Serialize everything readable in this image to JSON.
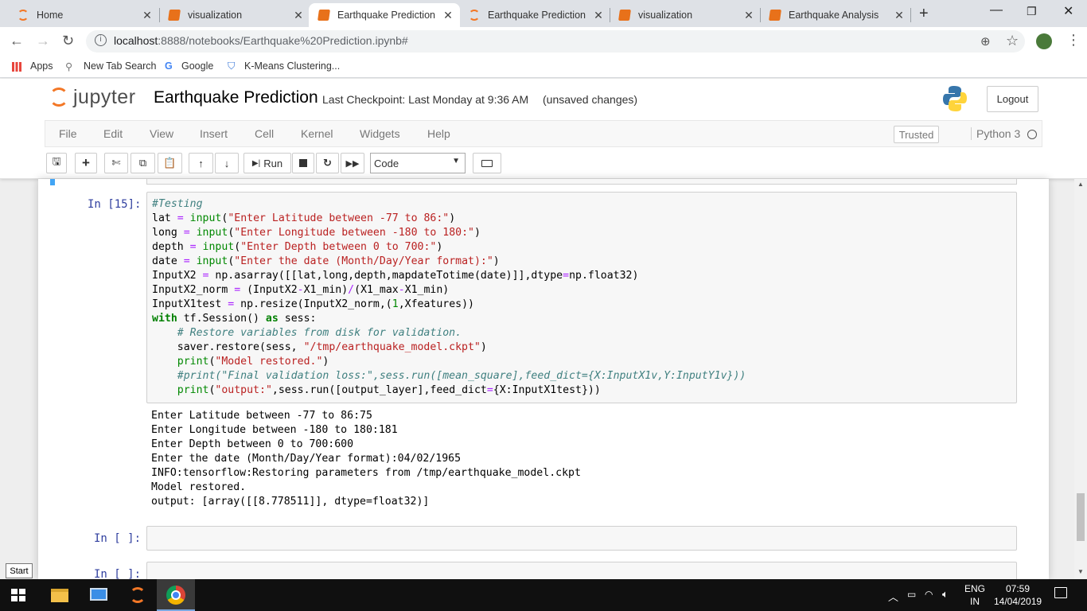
{
  "browser": {
    "tabs": [
      {
        "label": "Home",
        "icon": "jupyter-icon",
        "active": false
      },
      {
        "label": "visualization",
        "icon": "notebook-icon",
        "active": false
      },
      {
        "label": "Earthquake Prediction",
        "icon": "notebook-icon",
        "active": true
      },
      {
        "label": "Earthquake Prediction",
        "icon": "jupyter-icon",
        "active": false
      },
      {
        "label": "visualization",
        "icon": "notebook-icon",
        "active": false
      },
      {
        "label": "Earthquake Analysis",
        "icon": "notebook-icon",
        "active": false
      }
    ],
    "url_host": "localhost",
    "url_rest": ":8888/notebooks/Earthquake%20Prediction.ipynb#",
    "bookmarks": [
      "Apps",
      "New Tab Search",
      "Google",
      "K-Means Clustering..."
    ]
  },
  "jupyter": {
    "logo_text": "jupyter",
    "notebook_title": "Earthquake Prediction",
    "checkpoint": "Last Checkpoint: Last Monday at 9:36 AM",
    "unsaved": "(unsaved changes)",
    "logout": "Logout",
    "menus": [
      "File",
      "Edit",
      "View",
      "Insert",
      "Cell",
      "Kernel",
      "Widgets",
      "Help"
    ],
    "trusted": "Trusted",
    "kernel": "Python 3",
    "toolbar": {
      "run_label": "Run",
      "cell_type": "Code"
    }
  },
  "cells": {
    "cell1": {
      "prompt": "In [15]:",
      "code_lines": [
        "#Testing",
        "lat = input(\"Enter Latitude between -77 to 86:\")",
        "long = input(\"Enter Longitude between -180 to 180:\")",
        "depth = input(\"Enter Depth between 0 to 700:\")",
        "date = input(\"Enter the date (Month/Day/Year format):\")",
        "InputX2 = np.asarray([[lat,long,depth,mapdateTotime(date)]],dtype=np.float32)",
        "InputX2_norm = (InputX2-X1_min)/(X1_max-X1_min)",
        "InputX1test = np.resize(InputX2_norm,(1,Xfeatures))",
        "with tf.Session() as sess:",
        "    # Restore variables from disk for validation.",
        "    saver.restore(sess, \"/tmp/earthquake_model.ckpt\")",
        "    print(\"Model restored.\")",
        "    #print(\"Final validation loss:\",sess.run([mean_square],feed_dict={X:InputX1v,Y:InputY1v}))",
        "    print(\"output:\",sess.run([output_layer],feed_dict={X:InputX1test}))"
      ],
      "output_lines": [
        "Enter Latitude between -77 to 86:75",
        "Enter Longitude between -180 to 180:181",
        "Enter Depth between 0 to 700:600",
        "Enter the date (Month/Day/Year format):04/02/1965",
        "INFO:tensorflow:Restoring parameters from /tmp/earthquake_model.ckpt",
        "Model restored.",
        "output: [array([[8.778511]], dtype=float32)]"
      ]
    },
    "cell2": {
      "prompt": "In [ ]:"
    },
    "cell3": {
      "prompt": "In [ ]:"
    }
  },
  "taskbar": {
    "start_label": "Start",
    "lang_top": "ENG",
    "lang_bottom": "IN",
    "time": "07:59",
    "date": "14/04/2019"
  }
}
